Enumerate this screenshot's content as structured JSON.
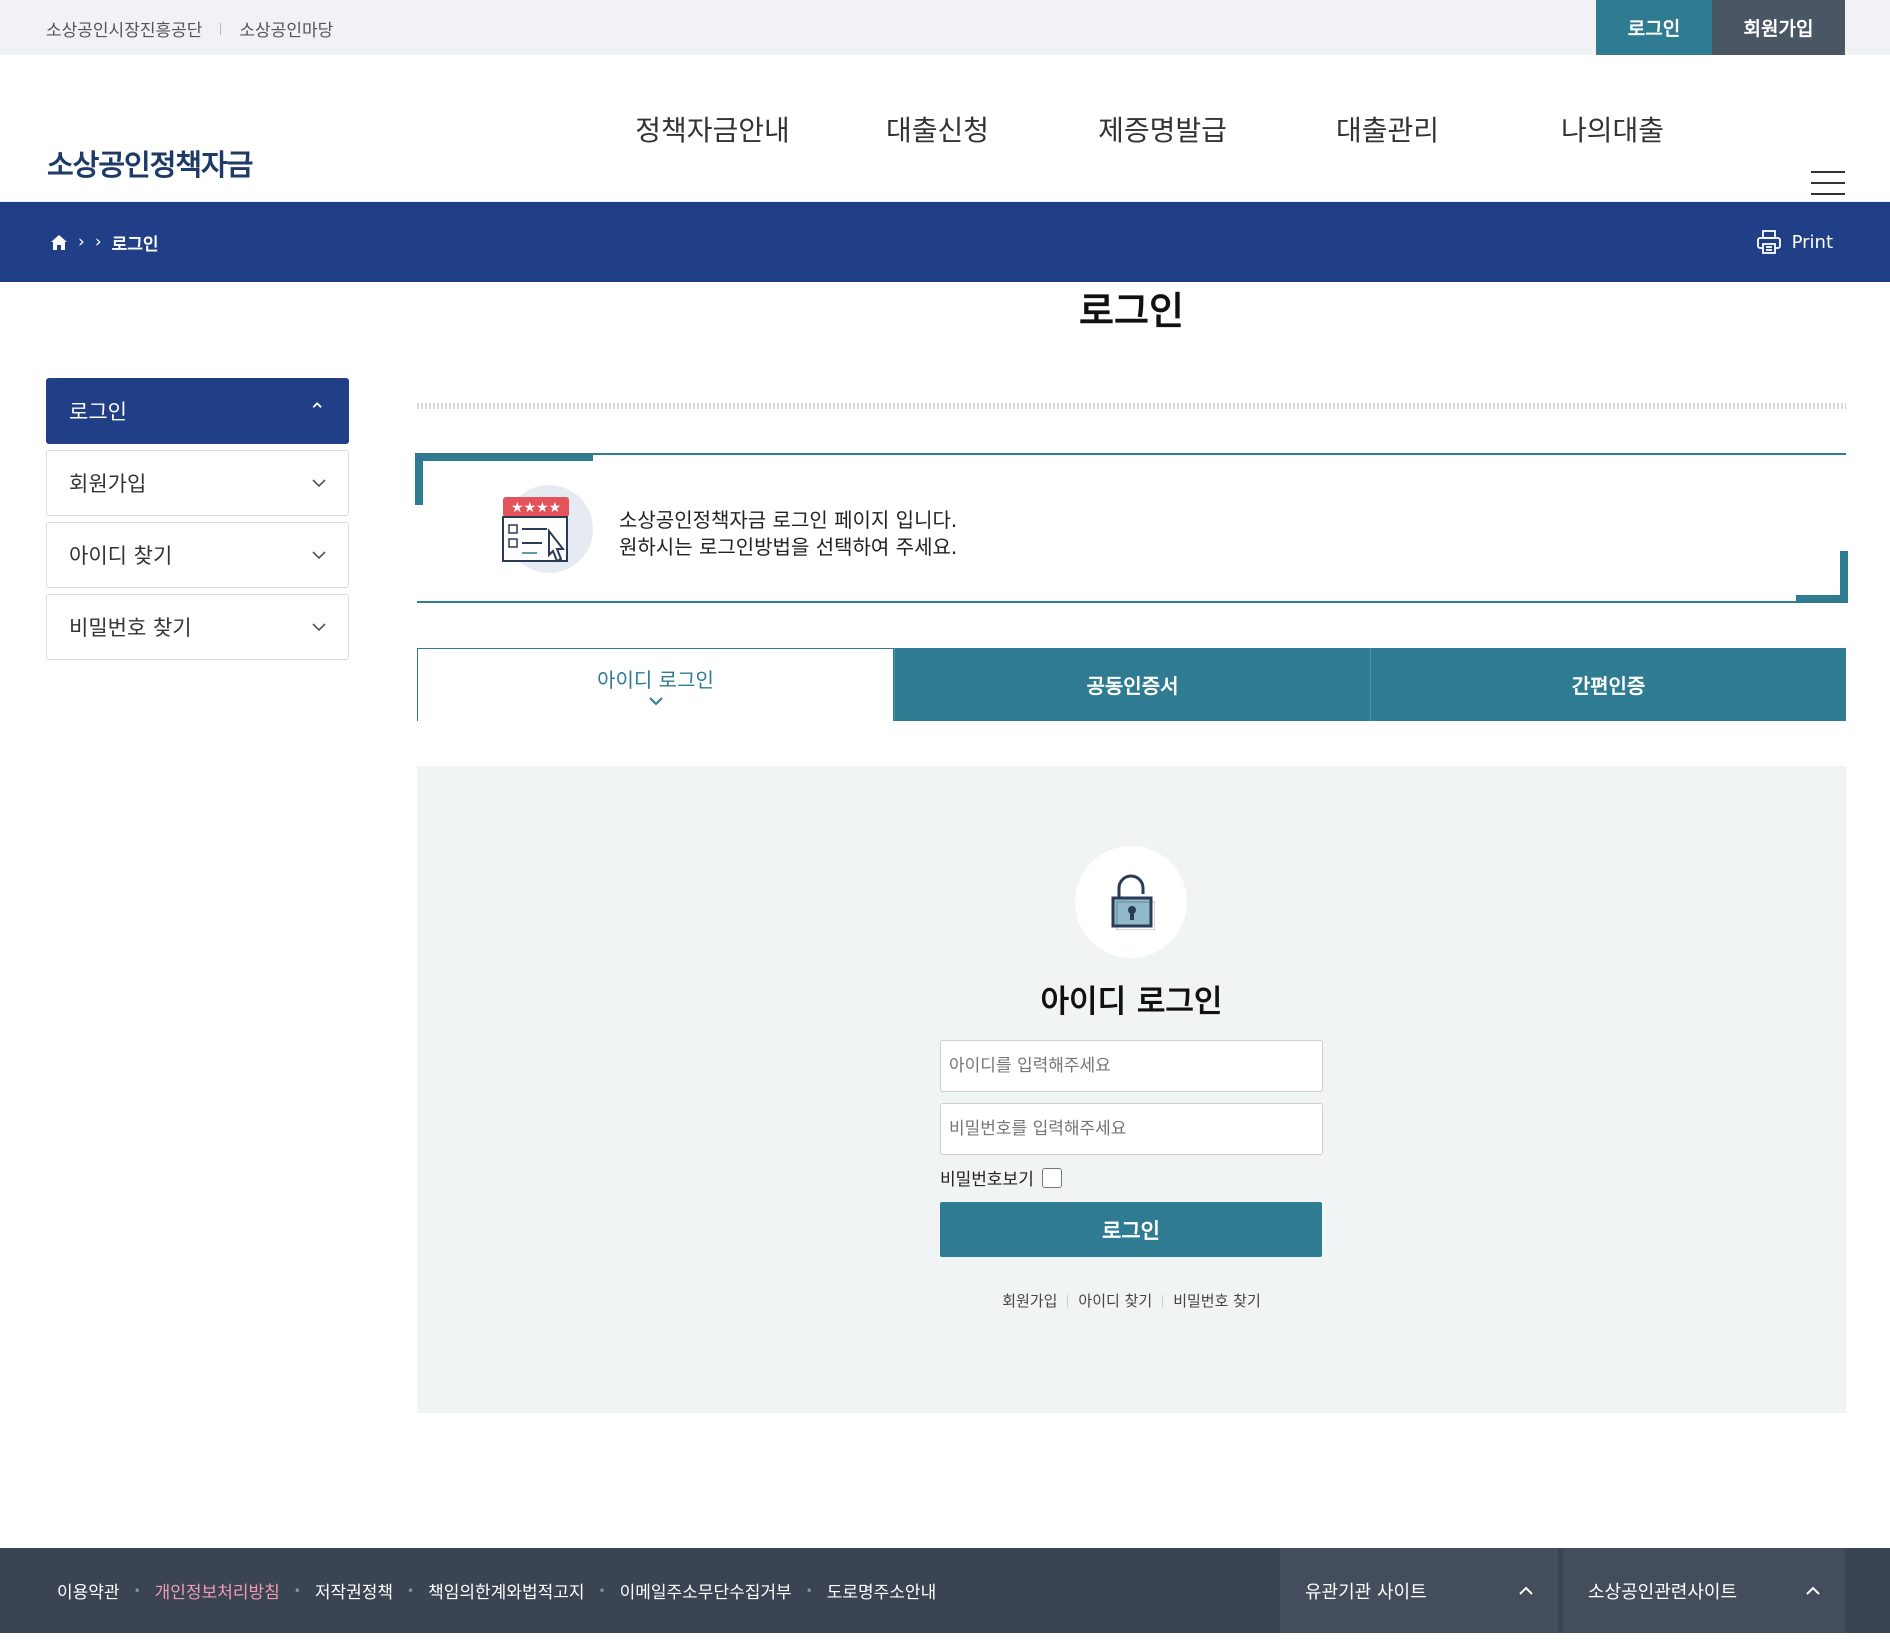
{
  "topbar": {
    "links": [
      "소상공인시장진흥공단",
      "소상공인마당"
    ],
    "login_label": "로그인",
    "join_label": "회원가입"
  },
  "header": {
    "logo": "소상공인정책자금",
    "nav": [
      "정책자금안내",
      "대출신청",
      "제증명발급",
      "대출관리",
      "나의대출"
    ]
  },
  "breadcrumb": {
    "current": "로그인",
    "print_label": "Print"
  },
  "sidebar": {
    "items": [
      {
        "label": "로그인",
        "active": true
      },
      {
        "label": "회원가입",
        "active": false
      },
      {
        "label": "아이디 찾기",
        "active": false
      },
      {
        "label": "비밀번호 찾기",
        "active": false
      }
    ]
  },
  "main": {
    "title": "로그인",
    "intro_line1": "소상공인정책자금 로그인 페이지 입니다.",
    "intro_line2": "원하시는 로그인방법을 선택하여 주세요.",
    "tabs": [
      {
        "label": "아이디 로그인",
        "active": true
      },
      {
        "label": "공동인증서",
        "active": false
      },
      {
        "label": "간편인증",
        "active": false
      }
    ],
    "panel_title": "아이디 로그인",
    "id_placeholder": "아이디를 입력해주세요",
    "pw_placeholder": "비밀번호를 입력해주세요",
    "show_pw_label": "비밀번호보기",
    "login_button": "로그인",
    "sublinks": [
      "회원가입",
      "아이디 찾기",
      "비밀번호 찾기"
    ]
  },
  "footer": {
    "links": [
      "이용약관",
      "개인정보처리방침",
      "저작권정책",
      "책임의한계와법적고지",
      "이메일주소무단수집거부",
      "도로명주소안내"
    ],
    "select1": "유관기관 사이트",
    "select2": "소상공인관련사이트"
  },
  "colors": {
    "primary_navy": "#213f86",
    "teal": "#2f7b92",
    "footer_bg": "#3b4452",
    "highlight_pink": "#f09bb7"
  }
}
